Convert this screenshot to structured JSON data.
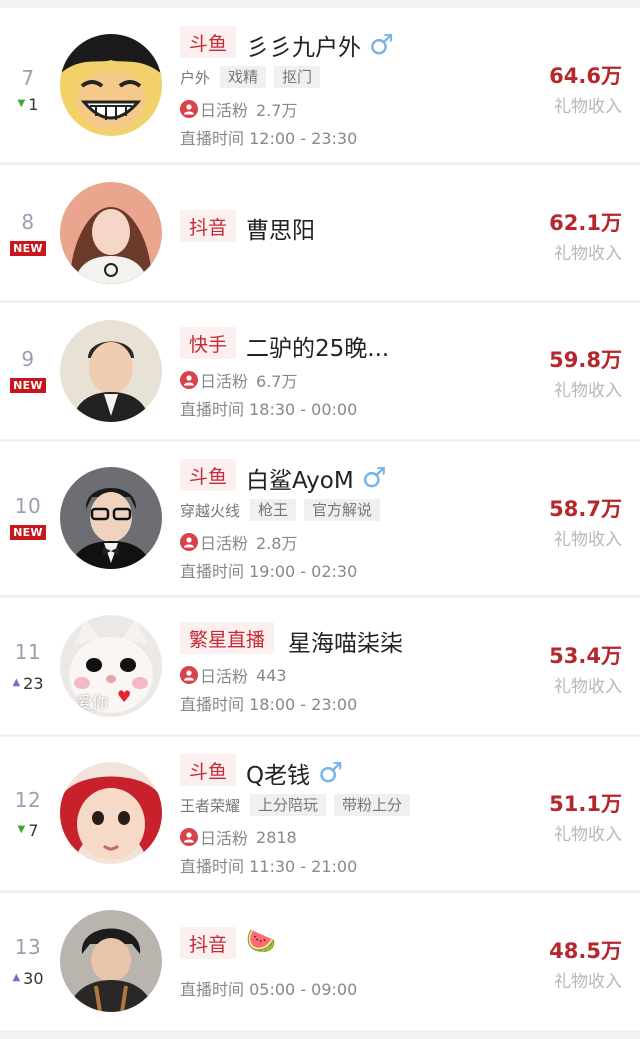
{
  "colors": {
    "accent": "#b5272d",
    "platform_bg": "#fbeff0",
    "new_badge": "#c8161d",
    "down_arrow": "#3aa63a",
    "up_arrow": "#6f6fd8",
    "gender": "#7ab4e6"
  },
  "gift_label": "礼物收入",
  "fans_label": "日活粉",
  "time_label": "直播时间",
  "new_label": "NEW",
  "entries": [
    {
      "rank": "7",
      "change": "1",
      "trend": "down",
      "platform": "斗鱼",
      "name": "彡彡九户外",
      "gender_icon": "male-icon",
      "category": "户外",
      "tags": [
        "戏精",
        "抠门"
      ],
      "fans": "2.7万",
      "time": "12:00 - 23:30",
      "amount": "64.6万"
    },
    {
      "rank": "8",
      "change": "",
      "trend": "new",
      "platform": "抖音",
      "name": "曹思阳",
      "gender_icon": "",
      "category": "",
      "tags": [],
      "fans": "",
      "time": "",
      "amount": "62.1万"
    },
    {
      "rank": "9",
      "change": "",
      "trend": "new",
      "platform": "快手",
      "name": "二驴的25晚...",
      "gender_icon": "",
      "category": "",
      "tags": [],
      "fans": "6.7万",
      "time": "18:30 - 00:00",
      "amount": "59.8万"
    },
    {
      "rank": "10",
      "change": "",
      "trend": "new",
      "platform": "斗鱼",
      "name": "白鲨AyoM",
      "gender_icon": "male-icon",
      "category": "穿越火线",
      "tags": [
        "枪王",
        "官方解说"
      ],
      "fans": "2.8万",
      "time": "19:00 - 02:30",
      "amount": "58.7万"
    },
    {
      "rank": "11",
      "change": "23",
      "trend": "up",
      "platform": "繁星直播",
      "name": "星海喵柒柒",
      "gender_icon": "",
      "category": "",
      "tags": [],
      "fans": "443",
      "time": "18:00 - 23:00",
      "amount": "53.4万",
      "avatar_text": "爱你"
    },
    {
      "rank": "12",
      "change": "7",
      "trend": "down",
      "platform": "斗鱼",
      "name": "Q老钱",
      "gender_icon": "male-icon",
      "category": "王者荣耀",
      "tags": [
        "上分陪玩",
        "带粉上分"
      ],
      "fans": "2818",
      "time": "11:30 - 21:00",
      "amount": "51.1万"
    },
    {
      "rank": "13",
      "change": "30",
      "trend": "up",
      "platform": "抖音",
      "name": "",
      "gender_icon": "watermelon-icon",
      "category": "",
      "tags": [],
      "fans": "",
      "time": "05:00 - 09:00",
      "amount": "48.5万"
    }
  ]
}
